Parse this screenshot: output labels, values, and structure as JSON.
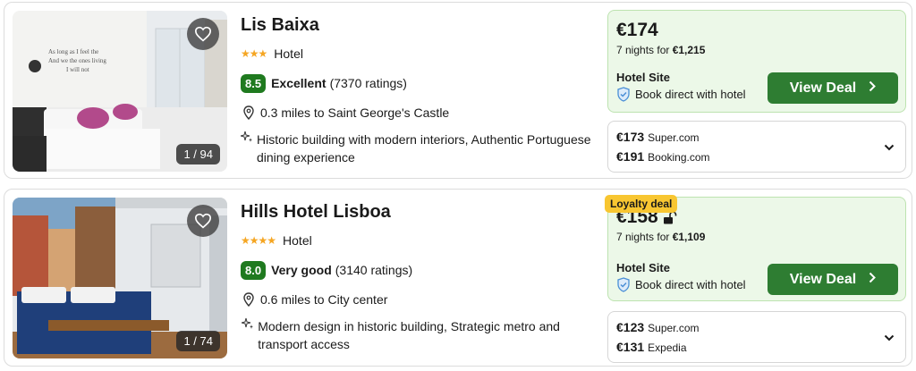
{
  "hotels": [
    {
      "name": "Lis Baixa",
      "stars": "★★★",
      "type": "Hotel",
      "score": "8.5",
      "rating_word": "Excellent",
      "rating_count": "(7370 ratings)",
      "distance": "0.3 miles to Saint George's Castle",
      "features": "Historic building with modern interiors, Authentic Portuguese dining experience",
      "photo_counter": "1 / 94",
      "price": "€174",
      "nights_prefix": "7 nights for ",
      "nights_total": "€1,215",
      "site_label": "Hotel Site",
      "direct_label": "Book direct with hotel",
      "view_deal_label": "View Deal",
      "other_offers": [
        {
          "price": "€173",
          "provider": "Super.com"
        },
        {
          "price": "€191",
          "provider": "Booking.com"
        }
      ]
    },
    {
      "name": "Hills Hotel Lisboa",
      "stars": "★★★★",
      "type": "Hotel",
      "score": "8.0",
      "rating_word": "Very good",
      "rating_count": "(3140 ratings)",
      "distance": "0.6 miles to City center",
      "features": "Modern design in historic building, Strategic metro and transport access",
      "photo_counter": "1 / 74",
      "loyalty_badge": "Loyalty deal",
      "price": "€158",
      "nights_prefix": "7 nights for ",
      "nights_total": "€1,109",
      "site_label": "Hotel Site",
      "direct_label": "Book direct with hotel",
      "view_deal_label": "View Deal",
      "other_offers": [
        {
          "price": "€123",
          "provider": "Super.com"
        },
        {
          "price": "€131",
          "provider": "Expedia"
        }
      ]
    }
  ],
  "colors": {
    "score_green": "#1f7a1f",
    "deal_bg": "#ecf8e8",
    "button_green": "#2e7d32",
    "star_orange": "#f5a623",
    "loyalty_yellow": "#f8c631",
    "shield_blue": "#4a8fd6"
  },
  "icons": [
    "heart-icon",
    "pin-icon",
    "sparkle-icon",
    "shield-check-icon",
    "chevron-right-icon",
    "chevron-down-icon",
    "unlock-icon"
  ]
}
